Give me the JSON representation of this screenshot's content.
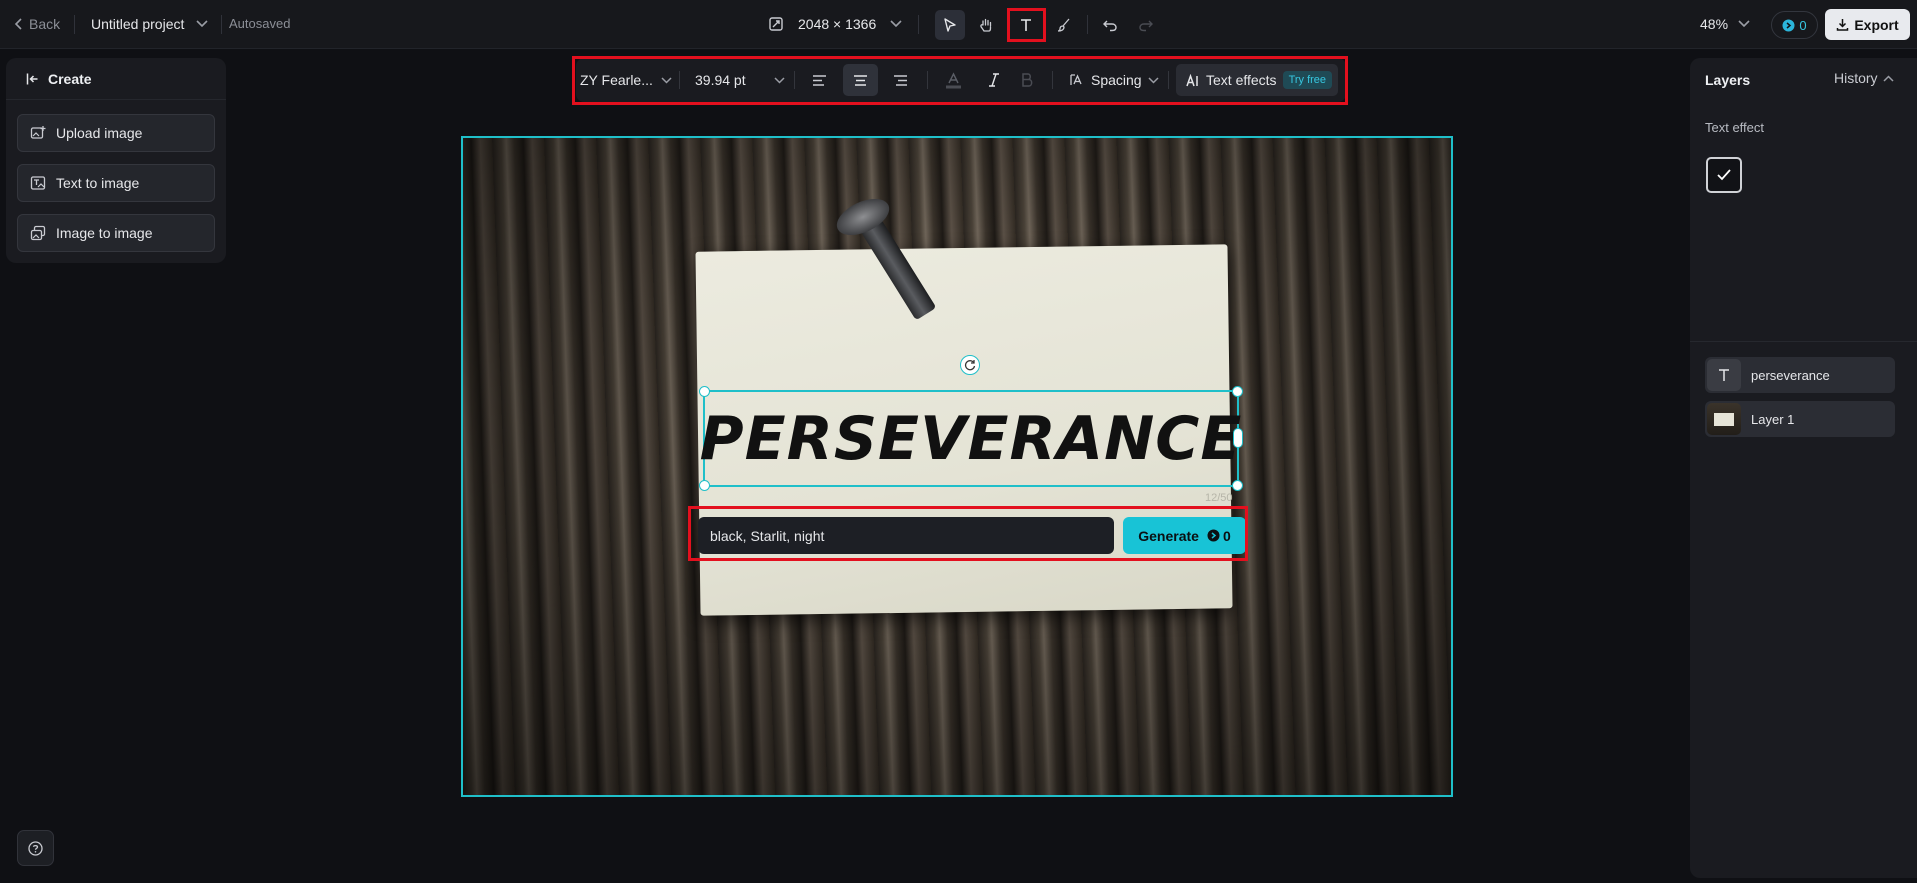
{
  "topbar": {
    "back_label": "Back",
    "project_name": "Untitled project",
    "save_status": "Autosaved",
    "canvas_size": "2048 × 1366",
    "zoom": "48%",
    "credits": "0",
    "export_label": "Export"
  },
  "left_panel": {
    "header": "Create",
    "buttons": [
      {
        "label": "Upload image",
        "icon": "upload-image-icon"
      },
      {
        "label": "Text to image",
        "icon": "text-to-image-icon"
      },
      {
        "label": "Image to image",
        "icon": "image-to-image-icon"
      }
    ]
  },
  "text_toolbar": {
    "font": "ZY Fearle...",
    "size": "39.94 pt",
    "alignment": "center",
    "spacing_label": "Spacing",
    "effects_label": "Text effects",
    "try_free": "Try free"
  },
  "canvas": {
    "text": "PERSEVERANCE",
    "char_counter": "12/50",
    "prompt_value": "black, Starlit, night",
    "generate_label": "Generate",
    "generate_cost": "0"
  },
  "right_panel": {
    "title": "Layers",
    "history_label": "History",
    "text_effect_label": "Text effect",
    "layers": [
      {
        "name": "perseverance",
        "type": "text"
      },
      {
        "name": "Layer 1",
        "type": "image"
      }
    ]
  },
  "colors": {
    "accent": "#18c3d6",
    "highlight": "#e3101e",
    "background": "#0f1014"
  }
}
